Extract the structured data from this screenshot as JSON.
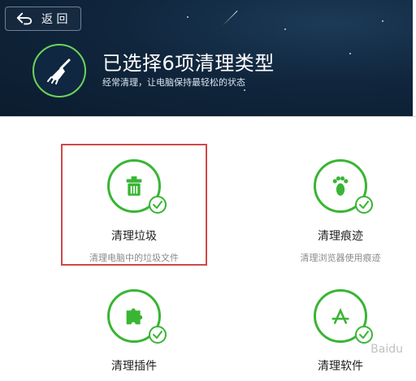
{
  "header": {
    "back_label": "返 回",
    "title": "已选择6项清理类型",
    "subtitle": "经常清理，让电脑保持最轻松的状态"
  },
  "cards": [
    {
      "label": "清理垃圾",
      "desc": "清理电脑中的垃圾文件",
      "selected": true
    },
    {
      "label": "清理痕迹",
      "desc": "清理浏览器使用痕迹",
      "selected": false
    },
    {
      "label": "清理插件",
      "desc": "",
      "selected": false
    },
    {
      "label": "清理软件",
      "desc": "",
      "selected": false
    }
  ],
  "colors": {
    "accent_green": "#39b534",
    "selection_red": "#d04848",
    "header_dark": "#10263d"
  },
  "watermark": {
    "text": "Baidu"
  }
}
